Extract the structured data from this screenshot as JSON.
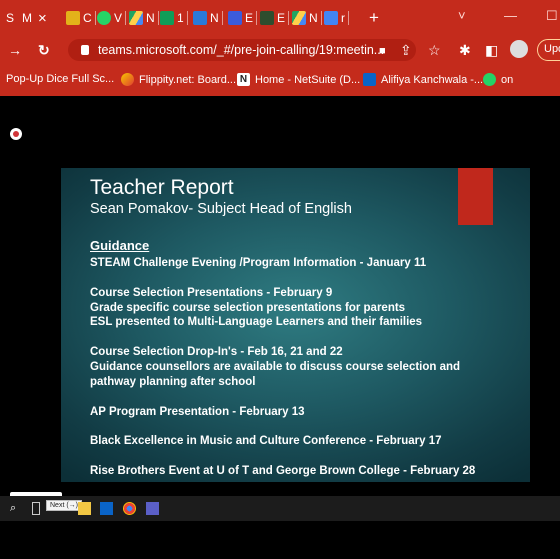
{
  "browser": {
    "theme_color": "#c42b1c",
    "tabs": [
      {
        "label": "S",
        "icon": "generic-tab-icon"
      },
      {
        "label": "M",
        "icon": "generic-tab-icon"
      },
      {
        "label": "C",
        "icon": "m-icon"
      },
      {
        "label": "V",
        "icon": "whatsapp-icon"
      },
      {
        "label": "N",
        "icon": "drive-icon"
      },
      {
        "label": "1",
        "icon": "plus-cross-icon"
      },
      {
        "label": "N",
        "icon": "grid-icon"
      },
      {
        "label": "E",
        "icon": "eye-icon"
      },
      {
        "label": "E",
        "icon": "tree-icon"
      },
      {
        "label": "N",
        "icon": "drive-icon"
      },
      {
        "label": "r",
        "icon": "doc-icon"
      }
    ],
    "active_tab_close": "×",
    "new_tab": "+",
    "window_controls": {
      "chevron": "˅",
      "minimize": "—",
      "maximize": "☐"
    },
    "url": "teams.microsoft.com/_#/pre-join-calling/19:meetin...",
    "update_label": "Upd",
    "bookmarks": [
      {
        "label": "Pop-Up Dice Full Sc...",
        "icon": "none"
      },
      {
        "label": "Flippity.net: Board...",
        "icon": "flippity-icon"
      },
      {
        "label": "Home - NetSuite (D...",
        "icon": "netsuite-icon"
      },
      {
        "label": "Alifiya Kanchwala -...",
        "icon": "outlook-icon"
      },
      {
        "label": "on",
        "icon": "whatsapp-icon"
      }
    ]
  },
  "slide": {
    "title": "Teacher Report",
    "subtitle": "Sean Pomakov- Subject Head of English",
    "heading": "Guidance",
    "groups": [
      [
        "STEAM Challenge Evening /Program Information - January 11"
      ],
      [
        "Course Selection Presentations - February 9",
        "Grade specific course selection presentations for parents",
        "ESL presented to Multi-Language Learners and their families"
      ],
      [
        "Course Selection Drop-In's - Feb 16, 21 and 22",
        "Guidance counsellors are available to discuss course selection and",
        "pathway planning after school"
      ],
      [
        "AP Program Presentation - February 13"
      ],
      [
        "Black Excellence in Music and Culture Conference - February 17"
      ],
      [
        "Rise Brothers Event at U of T and George Brown College - February 28"
      ]
    ],
    "accent_color": "#c0281c"
  },
  "taskbar": {
    "tooltip": "Next (→)"
  }
}
